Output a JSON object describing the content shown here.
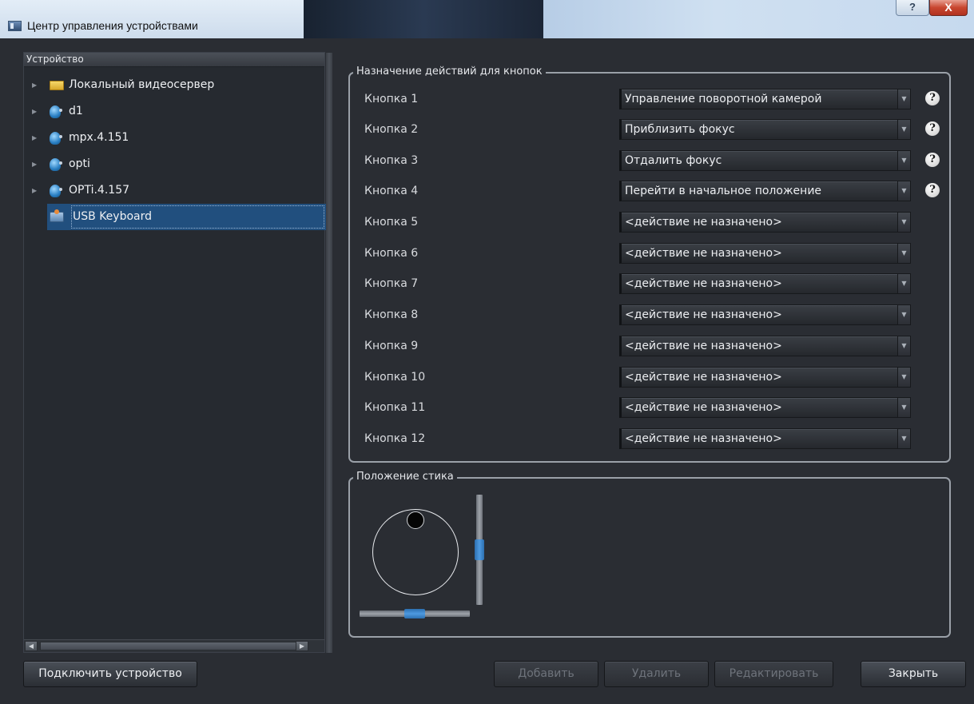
{
  "window": {
    "title": "Центр управления устройствами",
    "help_label": "?",
    "close_label": "X"
  },
  "devices": {
    "header": "Устройство",
    "items": [
      {
        "label": "Локальный видеосервер",
        "icon": "folder-icon",
        "expandable": true
      },
      {
        "label": "d1",
        "icon": "camera-icon",
        "expandable": true
      },
      {
        "label": "mpx.4.151",
        "icon": "camera-icon",
        "expandable": true
      },
      {
        "label": "opti",
        "icon": "camera-icon",
        "expandable": true
      },
      {
        "label": "OPTi.4.157",
        "icon": "camera-icon",
        "expandable": true
      },
      {
        "label": "USB Keyboard",
        "icon": "keyboard-icon",
        "expandable": false,
        "selected": true
      }
    ]
  },
  "button_assignments": {
    "title": "Назначение действий для кнопок",
    "rows": [
      {
        "label": "Кнопка 1",
        "action": "Управление поворотной камерой",
        "help": true
      },
      {
        "label": "Кнопка 2",
        "action": "Приблизить фокус",
        "help": true
      },
      {
        "label": "Кнопка 3",
        "action": "Отдалить фокус",
        "help": true
      },
      {
        "label": "Кнопка 4",
        "action": "Перейти в начальное положение",
        "help": true
      },
      {
        "label": "Кнопка 5",
        "action": "<действие не назначено>",
        "help": false
      },
      {
        "label": "Кнопка 6",
        "action": "<действие не назначено>",
        "help": false
      },
      {
        "label": "Кнопка 7",
        "action": "<действие не назначено>",
        "help": false
      },
      {
        "label": "Кнопка 8",
        "action": "<действие не назначено>",
        "help": false
      },
      {
        "label": "Кнопка 9",
        "action": "<действие не назначено>",
        "help": false
      },
      {
        "label": "Кнопка 10",
        "action": "<действие не назначено>",
        "help": false
      },
      {
        "label": "Кнопка 11",
        "action": "<действие не назначено>",
        "help": false
      },
      {
        "label": "Кнопка 12",
        "action": "<действие не назначено>",
        "help": false
      }
    ],
    "help_glyph": "?"
  },
  "stick": {
    "title": "Положение стика",
    "vertical_slider_level": 0.5,
    "horizontal_slider_level": 0.5
  },
  "footer": {
    "connect_label": "Подключить устройство",
    "add_label": "Добавить",
    "delete_label": "Удалить",
    "edit_label": "Редактировать",
    "close_label": "Закрыть"
  },
  "colors": {
    "background": "#2a2d33",
    "selection": "#214f7e",
    "slider_knob": "#3b86cf"
  }
}
